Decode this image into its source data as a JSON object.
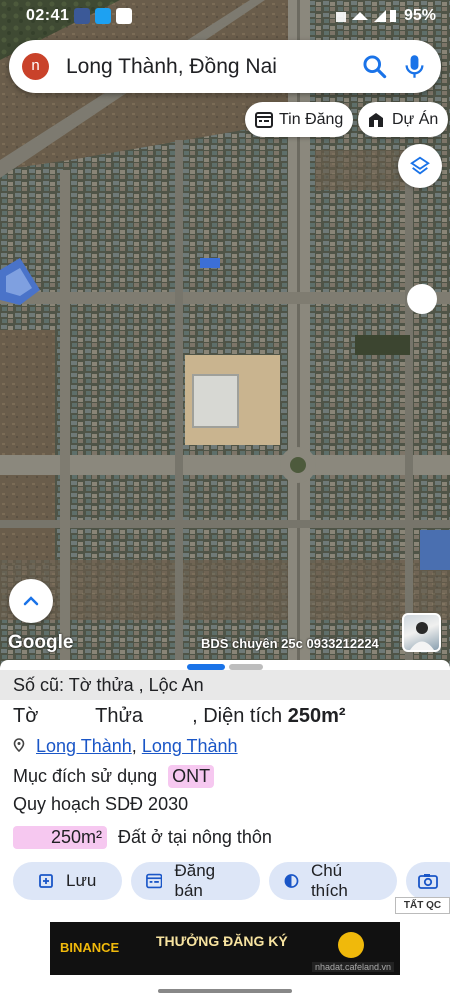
{
  "status_bar": {
    "time": "02:41",
    "battery": "95%"
  },
  "search": {
    "avatar_letter": "n",
    "query": "Long Thành, Đồng Nai"
  },
  "chips": {
    "listings": "Tin Đăng",
    "projects": "Dự Án"
  },
  "map": {
    "logo": "Google",
    "agent_label": "BDS chuyên 25c 0933212224"
  },
  "parcel": {
    "old_info": "Số cũ: Tờ      thửa      , Lộc An",
    "sheet_prefix": "Tờ",
    "plot_prefix": "Thửa",
    "area_prefix": ", Diện tích",
    "area_value": "250m²",
    "location_district": "Long Thành",
    "location_separator": ",",
    "location_city": "Long Thành",
    "purpose_label": "Mục đích sử dụng",
    "purpose_code": "ONT",
    "planning_label": "Quy hoạch SDĐ 2030",
    "planning_area": "250m²",
    "planning_desc": "Đất ở tại nông thôn"
  },
  "actions": {
    "save": "Lưu",
    "post_sale": "Đăng bán",
    "legend": "Chú thích"
  },
  "ad": {
    "tag": "TẤT QC",
    "brand": "BINANCE",
    "promo": "THƯỞNG ĐĂNG KÝ",
    "source": "nhadat.cafeland.vn"
  },
  "colors": {
    "accent_blue": "#1a73e8",
    "chip_pink": "#f6c8f0",
    "action_bg": "#dde6f7"
  }
}
